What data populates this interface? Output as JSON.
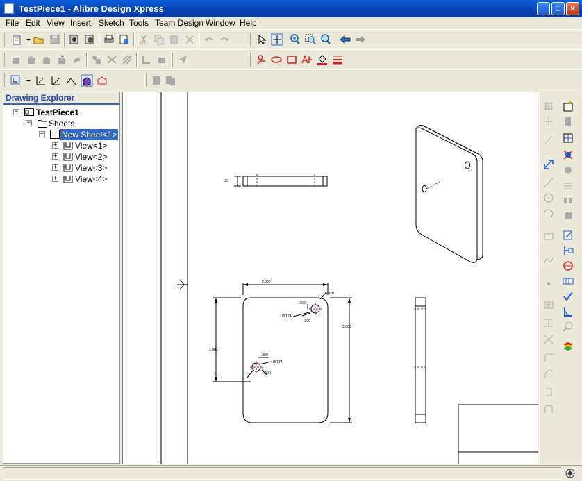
{
  "window": {
    "title": "TestPiece1 - Alibre Design Xpress",
    "minimize_glyph": "_",
    "maximize_glyph": "□",
    "close_glyph": "×"
  },
  "menu": {
    "items": [
      "File",
      "Edit",
      "View",
      "Insert",
      "Sketch",
      "Tools",
      "Team Design",
      "Window",
      "Help"
    ]
  },
  "explorer": {
    "title": "Drawing Explorer",
    "root": "TestPiece1",
    "sheets": "Sheets",
    "sheet": "New Sheet<1>",
    "views": [
      "View<1>",
      "View<2>",
      "View<3>",
      "View<4>"
    ],
    "expand_glyph": "+",
    "collapse_glyph": "−"
  },
  "drawing": {
    "dims": {
      "top_width": "2.000",
      "corner_radius": "R.200",
      "right_height": "3.000",
      "left_height": "2.000",
      "hole_top_x": ".300",
      "hole_top_y": ".300",
      "hole_top_dia": "Ø.174",
      "hole_mid_x": ".300",
      "hole_mid_y": ".300",
      "hole_mid_dia": "Ø.174",
      "thickness": ".25"
    }
  },
  "status": {
    "text": ""
  },
  "colors": {
    "title_bar": "#0a50c8",
    "explorer_title": "#1d4fbf",
    "selection": "#316ac5",
    "centerline": "#a0208c",
    "sketch_red": "#d42020"
  }
}
